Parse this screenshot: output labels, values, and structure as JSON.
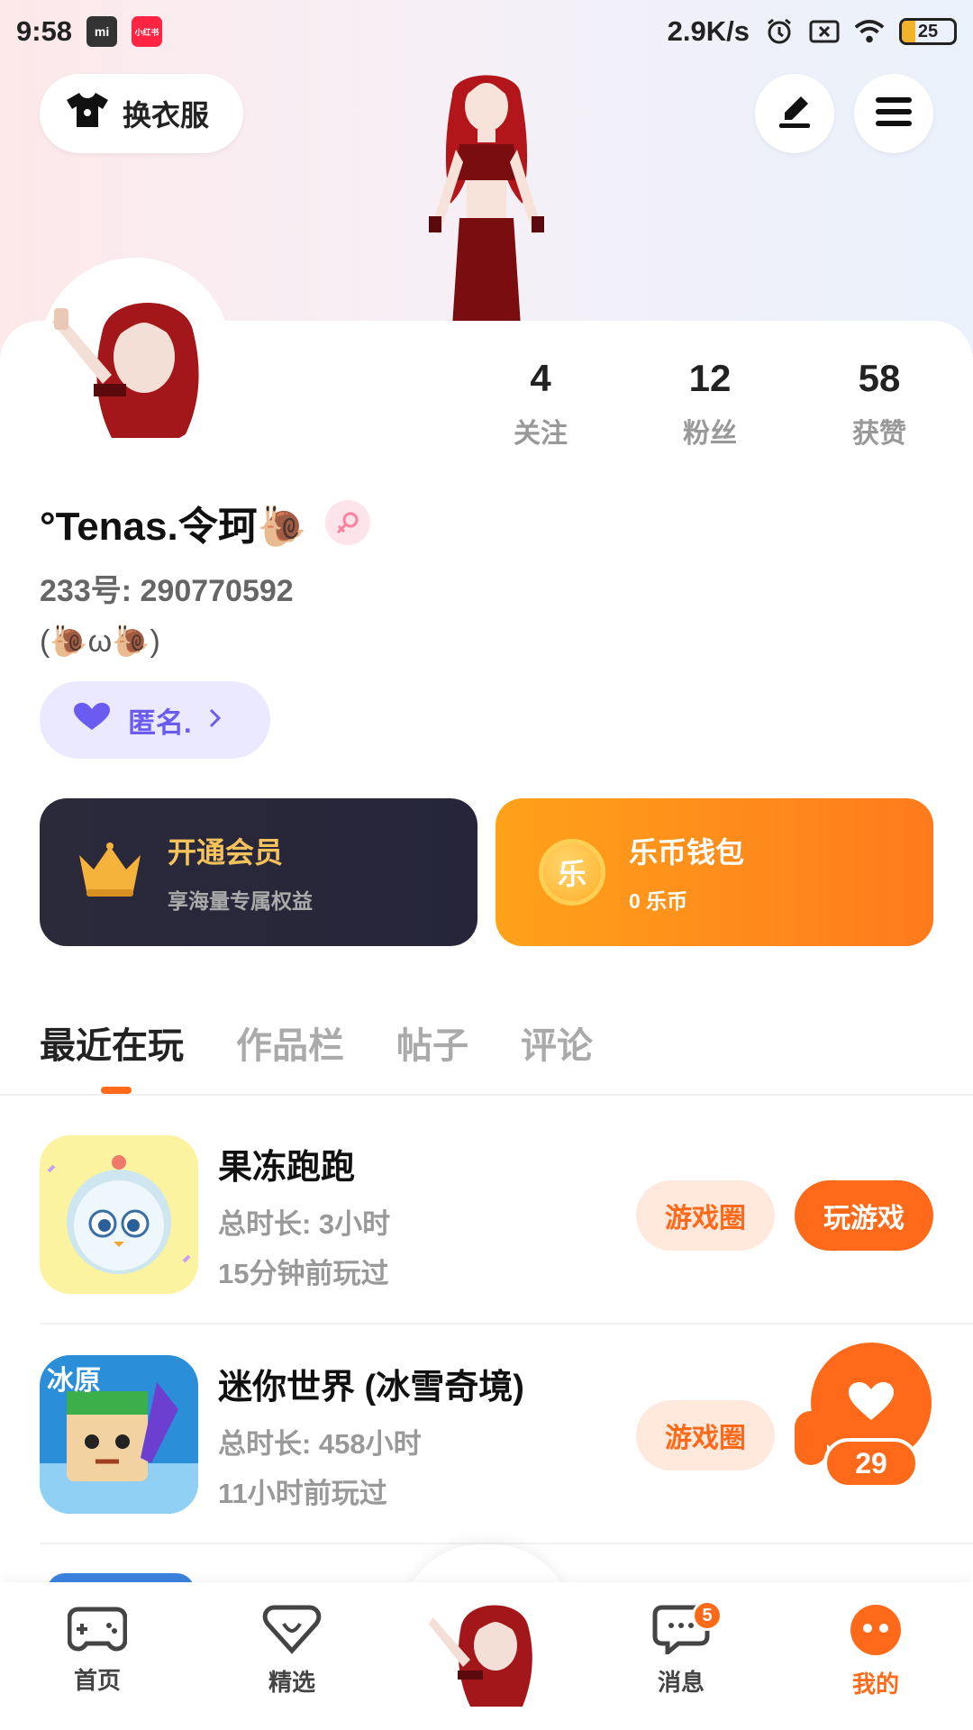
{
  "status_bar": {
    "time": "9:58",
    "mi_label": "mi",
    "xhs_label": "小红书",
    "net_speed": "2.9K/s",
    "battery": "25"
  },
  "header": {
    "dress_label": "换衣服"
  },
  "profile": {
    "stats": [
      {
        "num": "4",
        "label": "关注"
      },
      {
        "num": "12",
        "label": "粉丝"
      },
      {
        "num": "58",
        "label": "获赞"
      }
    ],
    "name": "°Tenas.令珂🐌",
    "uid": "233号: 290770592",
    "signature": "(🐌ω🐌)",
    "anon_label": "匿名."
  },
  "vip": {
    "title": "开通会员",
    "subtitle": "享海量专属权益"
  },
  "wallet": {
    "coin_char": "乐",
    "title": "乐币钱包",
    "subtitle": "0 乐币"
  },
  "tabs": [
    "最近在玩",
    "作品栏",
    "帖子",
    "评论"
  ],
  "games": [
    {
      "title": "果冻跑跑",
      "duration": "总时长: 3小时",
      "last": "15分钟前玩过",
      "circle_label": "游戏圈",
      "play_label": "玩游戏"
    },
    {
      "title": "迷你世界 (冰雪奇境)",
      "duration": "总时长: 458小时",
      "last": "11小时前玩过",
      "circle_label": "游戏圈",
      "icon_text": "冰原"
    }
  ],
  "like_count": "29",
  "nav": {
    "items": [
      "首页",
      "精选",
      "消息",
      "我的"
    ],
    "message_badge": "5"
  },
  "colors": {
    "accent": "#ff6a1a",
    "vip_gold": "#f6c25c",
    "anon_purple": "#6a5cf0"
  }
}
